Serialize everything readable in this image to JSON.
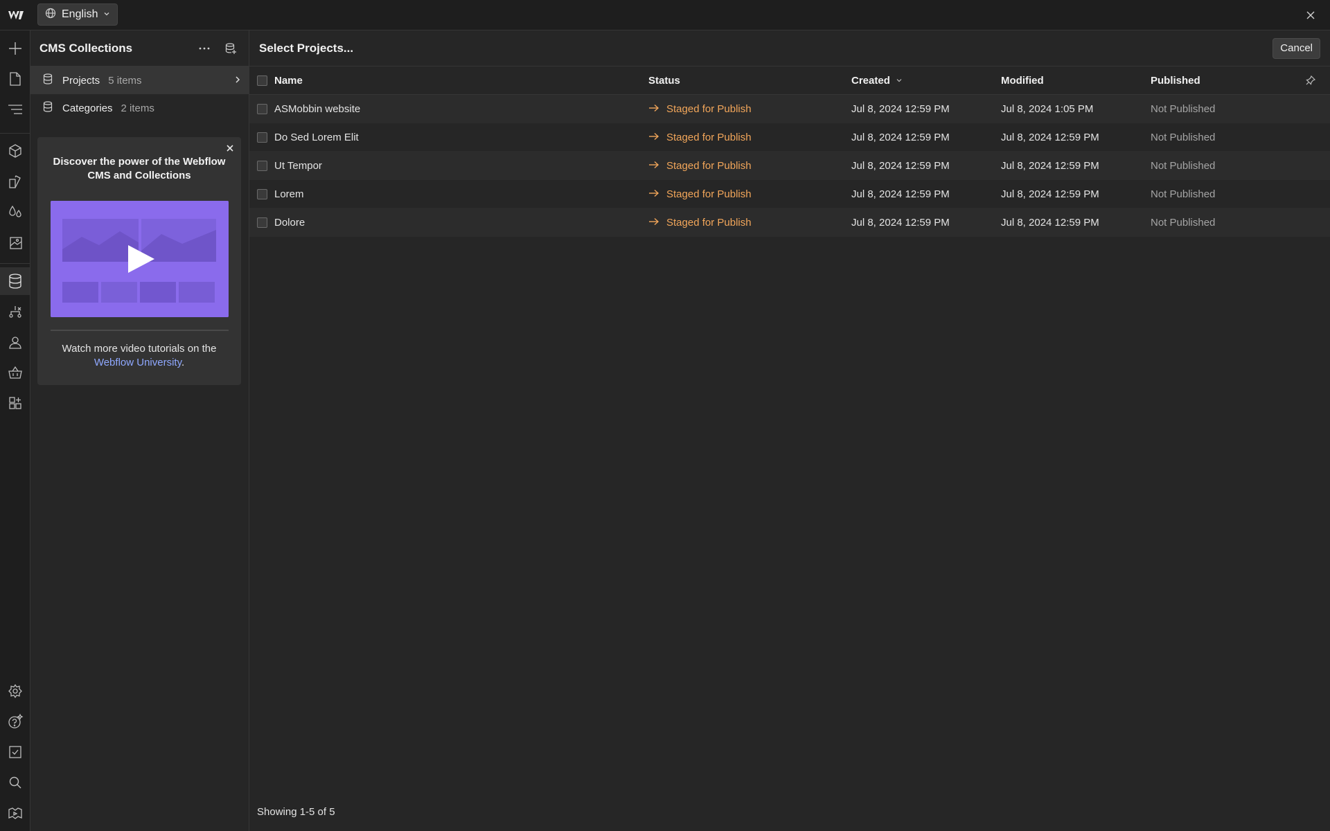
{
  "topbar": {
    "logo_icon": "webflow-logo",
    "locale_label": "English",
    "locale_icon": "globe-icon",
    "close_icon": "close-icon"
  },
  "rail": {
    "icons": [
      "add-icon",
      "page-icon",
      "navigator-icon",
      "components-icon",
      "style-selector-icon",
      "variables-icon",
      "assets-icon",
      "cms-icon",
      "logic-icon",
      "users-icon",
      "ecommerce-icon",
      "apps-icon",
      "settings-icon",
      "help-icon",
      "audit-icon",
      "search-icon",
      "video-icon"
    ],
    "active": "cms-icon"
  },
  "cms": {
    "title": "CMS Collections",
    "collections": [
      {
        "name": "Projects",
        "count": "5 items",
        "active": true
      },
      {
        "name": "Categories",
        "count": "2 items",
        "active": false
      }
    ],
    "promo": {
      "title": "Discover the power of the Webflow CMS and Collections",
      "footer_prefix": "Watch more video tutorials on the",
      "footer_link": "Webflow University",
      "footer_suffix": "."
    }
  },
  "main": {
    "title": "Select Projects...",
    "cancel_label": "Cancel",
    "columns": {
      "name": "Name",
      "status": "Status",
      "created": "Created",
      "modified": "Modified",
      "published": "Published"
    },
    "rows": [
      {
        "name": "ASMobbin website",
        "status": "Staged for Publish",
        "created": "Jul 8, 2024 12:59 PM",
        "modified": "Jul 8, 2024 1:05 PM",
        "published": "Not Published"
      },
      {
        "name": "Do Sed Lorem Elit",
        "status": "Staged for Publish",
        "created": "Jul 8, 2024 12:59 PM",
        "modified": "Jul 8, 2024 12:59 PM",
        "published": "Not Published"
      },
      {
        "name": "Ut Tempor",
        "status": "Staged for Publish",
        "created": "Jul 8, 2024 12:59 PM",
        "modified": "Jul 8, 2024 12:59 PM",
        "published": "Not Published"
      },
      {
        "name": "Lorem",
        "status": "Staged for Publish",
        "created": "Jul 8, 2024 12:59 PM",
        "modified": "Jul 8, 2024 12:59 PM",
        "published": "Not Published"
      },
      {
        "name": "Dolore",
        "status": "Staged for Publish",
        "created": "Jul 8, 2024 12:59 PM",
        "modified": "Jul 8, 2024 12:59 PM",
        "published": "Not Published"
      }
    ],
    "footer": "Showing 1-5 of 5"
  },
  "colors": {
    "status_staged": "#f2a65a",
    "link": "#8fa8ff",
    "promo_video": "#8a6bec"
  }
}
